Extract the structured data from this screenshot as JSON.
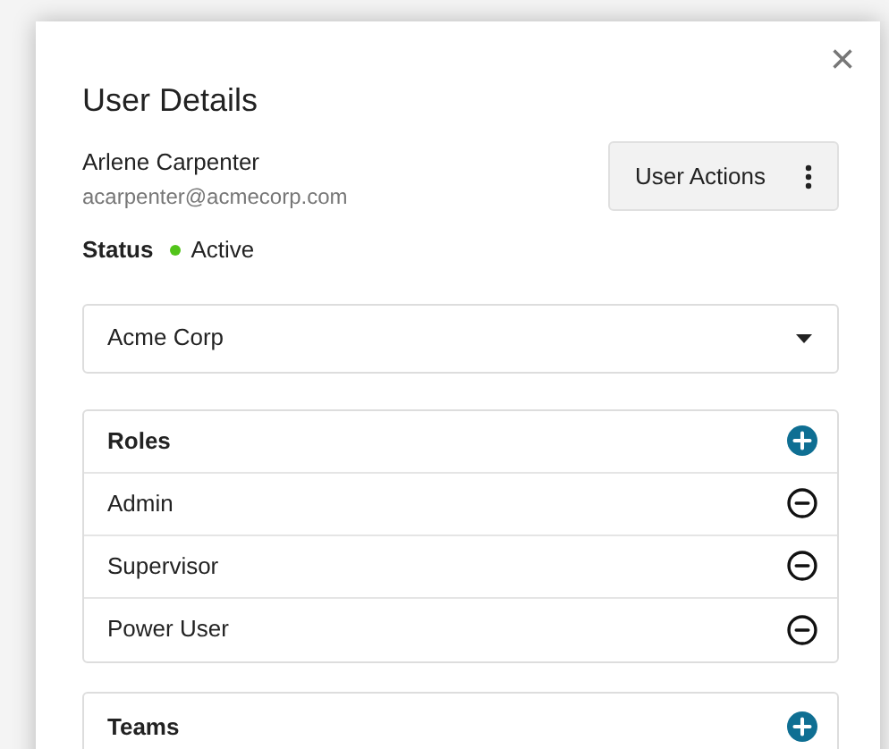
{
  "dialog": {
    "title": "User Details",
    "close": "×"
  },
  "user": {
    "name": "Arlene Carpenter",
    "email": "acarpenter@acmecorp.com",
    "actions_button": "User Actions",
    "status_label": "Status",
    "status": {
      "text": "Active",
      "color": "#52c41a"
    }
  },
  "organization_select": {
    "value": "Acme Corp"
  },
  "roles": {
    "title": "Roles",
    "items": [
      "Admin",
      "Supervisor",
      "Power User"
    ]
  },
  "teams": {
    "title": "Teams"
  }
}
